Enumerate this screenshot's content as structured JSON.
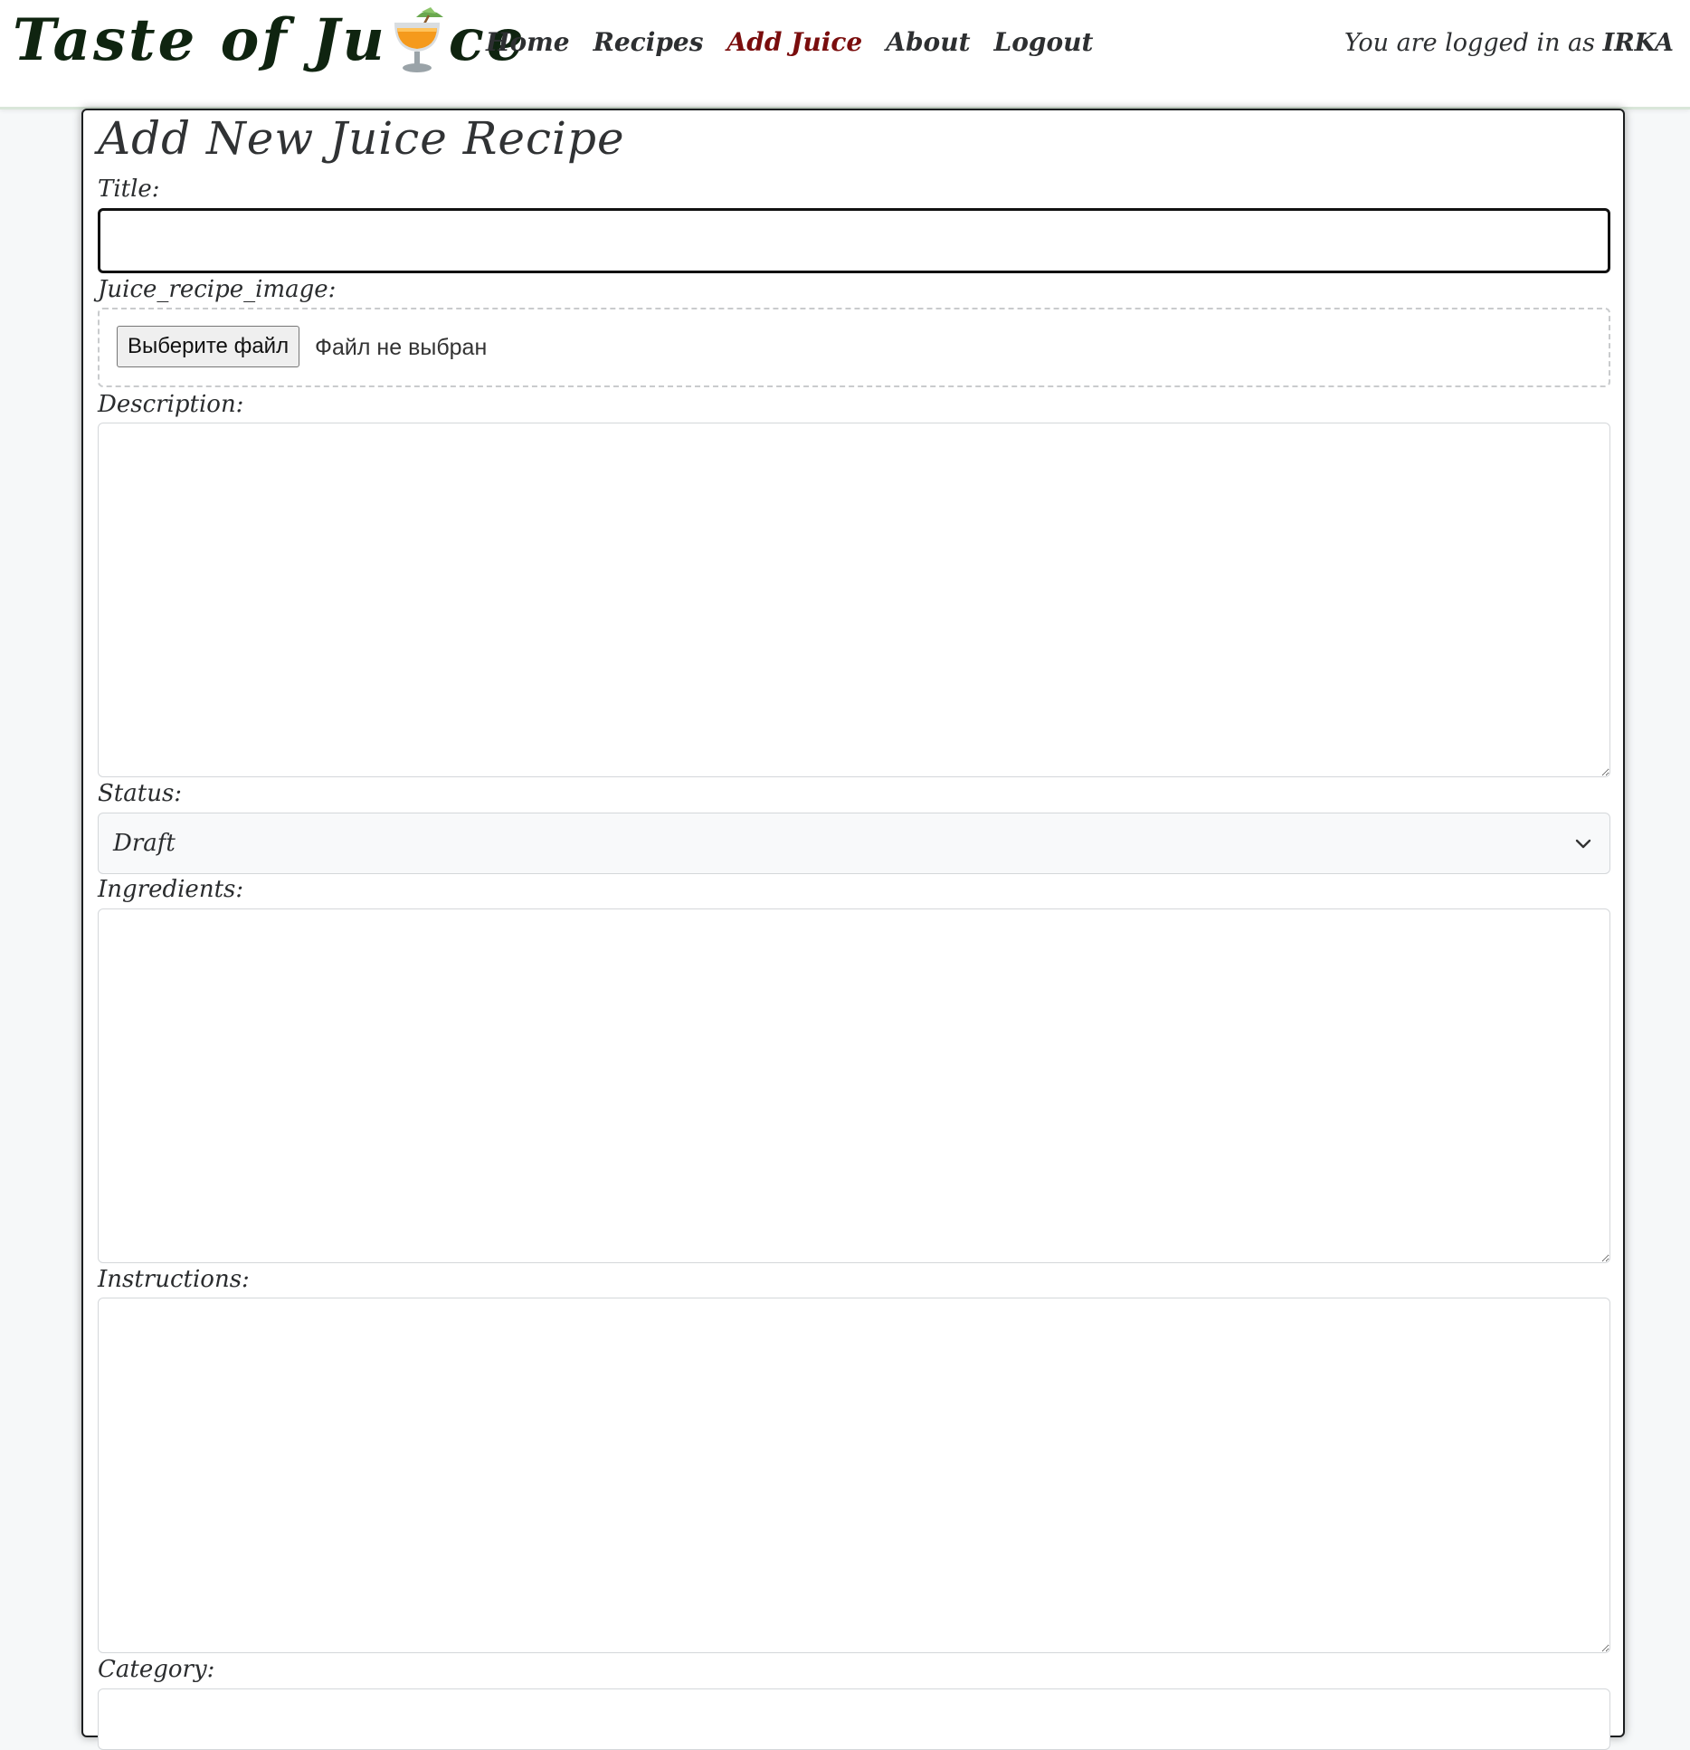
{
  "header": {
    "brand_left": "Taste of Ju",
    "brand_right": "ce",
    "brand_icon": "tropical-drink-icon",
    "nav": [
      {
        "label": "Home",
        "active": false
      },
      {
        "label": "Recipes",
        "active": false
      },
      {
        "label": "Add Juice",
        "active": true
      },
      {
        "label": "About",
        "active": false
      },
      {
        "label": "Logout",
        "active": false
      }
    ],
    "login_prefix": "You are logged in as",
    "username": "IRKA"
  },
  "form": {
    "title": "Add New Juice Recipe",
    "title_label": "Title:",
    "title_value": "",
    "image_label": "Juice_recipe_image:",
    "file_button": "Выберите файл",
    "file_status": "Файл не выбран",
    "description_label": "Description:",
    "status_label": "Status:",
    "status_value": "Draft",
    "ingredients_label": "Ingredients:",
    "instructions_label": "Instructions:",
    "category_label": "Category:"
  },
  "colors": {
    "brand": "#0f2410",
    "active_nav": "#7a0d0d",
    "text": "#2d2f31"
  }
}
